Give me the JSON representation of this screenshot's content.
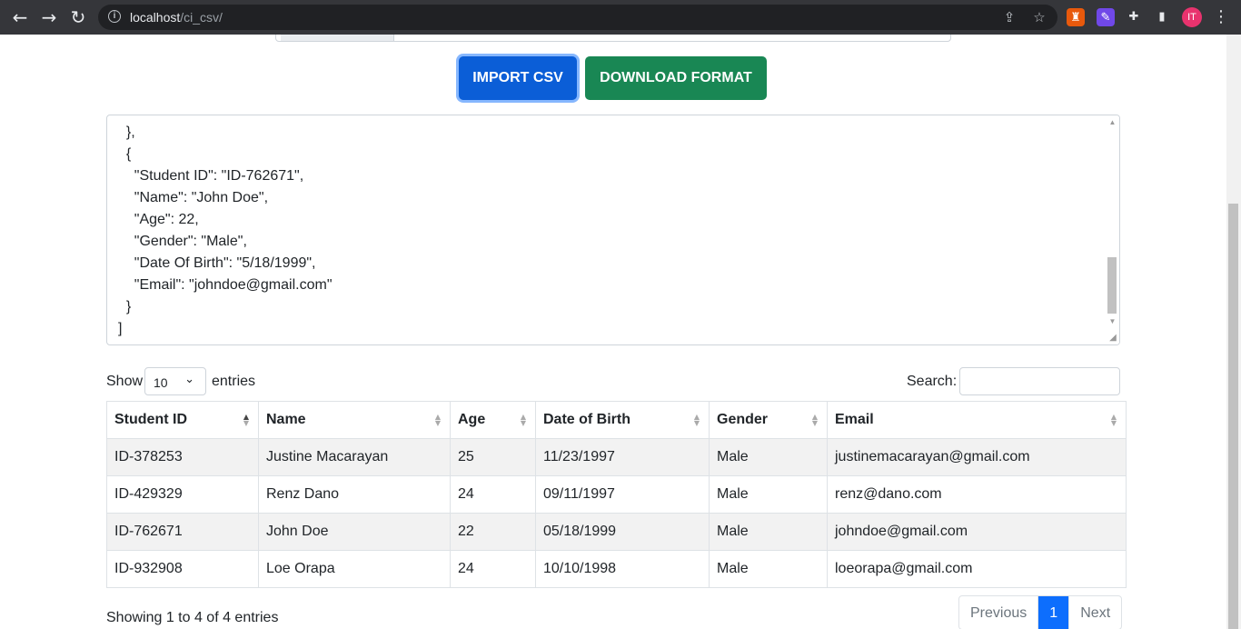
{
  "browser": {
    "url_host": "localhost",
    "url_path": "/ci_csv/",
    "avatar_initials": "IT"
  },
  "toolbar": {
    "import_label": "IMPORT CSV",
    "download_label": "DOWNLOAD FORMAT"
  },
  "json_output": {
    "lines": [
      "  },",
      "  {",
      "    \"Student ID\": \"ID-762671\",",
      "    \"Name\": \"John Doe\",",
      "    \"Age\": 22,",
      "    \"Gender\": \"Male\",",
      "    \"Date Of Birth\": \"5/18/1999\",",
      "    \"Email\": \"johndoe@gmail.com\"",
      "  }",
      "]"
    ]
  },
  "datatable": {
    "show_label": "Show",
    "length_value": "10",
    "entries_label": "entries",
    "search_label": "Search:",
    "search_value": "",
    "columns": [
      "Student ID",
      "Name",
      "Age",
      "Date of Birth",
      "Gender",
      "Email"
    ],
    "rows": [
      [
        "ID-378253",
        "Justine Macarayan",
        "25",
        "11/23/1997",
        "Male",
        "justinemacarayan@gmail.com"
      ],
      [
        "ID-429329",
        "Renz Dano",
        "24",
        "09/11/1997",
        "Male",
        "renz@dano.com"
      ],
      [
        "ID-762671",
        "John Doe",
        "22",
        "05/18/1999",
        "Male",
        "johndoe@gmail.com"
      ],
      [
        "ID-932908",
        "Loe Orapa",
        "24",
        "10/10/1998",
        "Male",
        "loeorapa@gmail.com"
      ]
    ],
    "info": "Showing 1 to 4 of 4 entries",
    "pagination": {
      "previous": "Previous",
      "current": "1",
      "next": "Next"
    }
  },
  "colors": {
    "primary": "#0b5ed7",
    "success": "#198754",
    "page_active": "#0d6efd"
  }
}
